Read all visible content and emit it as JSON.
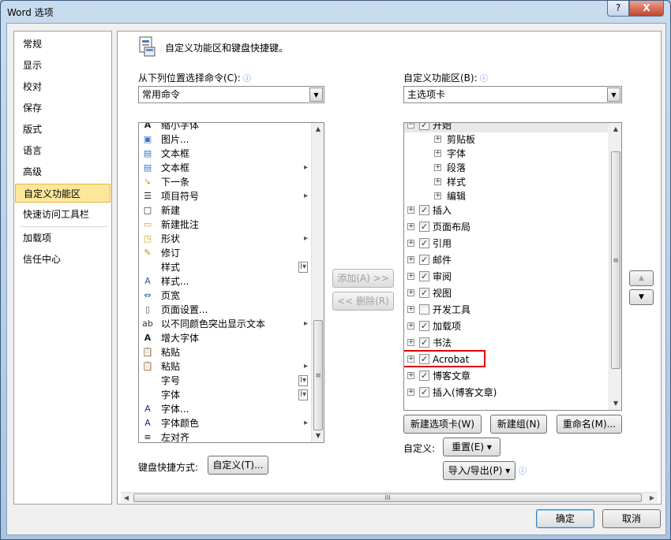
{
  "window": {
    "title": "Word 选项",
    "help": "?",
    "close": "X"
  },
  "nav": {
    "items": [
      "常规",
      "显示",
      "校对",
      "保存",
      "版式",
      "语言",
      "高级",
      "自定义功能区",
      "快速访问工具栏",
      "加载项",
      "信任中心"
    ],
    "selected": "自定义功能区"
  },
  "header": {
    "text": "自定义功能区和键盘快捷键。"
  },
  "left": {
    "label": "从下列位置选择命令(C):",
    "combo_value": "常用命令",
    "commands": [
      {
        "label": "缩小字体",
        "icon": "shrink-font-icon"
      },
      {
        "label": "图片...",
        "icon": "picture-icon"
      },
      {
        "label": "文本框",
        "icon": "textbox-icon"
      },
      {
        "label": "文本框",
        "icon": "textbox-icon",
        "sub": "▸"
      },
      {
        "label": "下一条",
        "icon": "next-icon"
      },
      {
        "label": "项目符号",
        "icon": "bullets-icon",
        "sub": "▸"
      },
      {
        "label": "新建",
        "icon": "new-icon"
      },
      {
        "label": "新建批注",
        "icon": "new-comment-icon"
      },
      {
        "label": "形状",
        "icon": "shapes-icon",
        "sub": "▸"
      },
      {
        "label": "修订",
        "icon": "track-changes-icon"
      },
      {
        "label": "样式",
        "icon": "",
        "sub": "I▾"
      },
      {
        "label": "样式...",
        "icon": "styles-icon"
      },
      {
        "label": "页宽",
        "icon": "page-width-icon"
      },
      {
        "label": "页面设置...",
        "icon": "page-setup-icon"
      },
      {
        "label": "以不同颜色突出显示文本",
        "icon": "highlight-icon",
        "sub": "▸"
      },
      {
        "label": "增大字体",
        "icon": "grow-font-icon"
      },
      {
        "label": "粘贴",
        "icon": "paste-icon"
      },
      {
        "label": "粘贴",
        "icon": "paste-icon",
        "sub": "▸"
      },
      {
        "label": "字号",
        "icon": "",
        "sub": "I▾"
      },
      {
        "label": "字体",
        "icon": "",
        "sub": "I▾"
      },
      {
        "label": "字体...",
        "icon": "font-dialog-icon"
      },
      {
        "label": "字体颜色",
        "icon": "font-color-icon",
        "sub": "▸"
      },
      {
        "label": "左对齐",
        "icon": "align-left-icon"
      }
    ]
  },
  "middle": {
    "add": "添加(A) >>",
    "remove": "<< 删除(R)"
  },
  "right": {
    "label": "自定义功能区(B):",
    "combo_value": "主选项卡",
    "tree": [
      {
        "label": "开始",
        "level": 0,
        "checked": true
      },
      {
        "label": "剪贴板",
        "level": 1
      },
      {
        "label": "字体",
        "level": 1
      },
      {
        "label": "段落",
        "level": 1
      },
      {
        "label": "样式",
        "level": 1
      },
      {
        "label": "编辑",
        "level": 1
      },
      {
        "label": "插入",
        "level": 0,
        "checked": true
      },
      {
        "label": "页面布局",
        "level": 0,
        "checked": true
      },
      {
        "label": "引用",
        "level": 0,
        "checked": true
      },
      {
        "label": "邮件",
        "level": 0,
        "checked": true
      },
      {
        "label": "审阅",
        "level": 0,
        "checked": true
      },
      {
        "label": "视图",
        "level": 0,
        "checked": true
      },
      {
        "label": "开发工具",
        "level": 0,
        "checked": false
      },
      {
        "label": "加载项",
        "level": 0,
        "checked": true
      },
      {
        "label": "书法",
        "level": 0,
        "checked": true
      },
      {
        "label": "Acrobat",
        "level": 0,
        "checked": true,
        "highlight": true
      },
      {
        "label": "博客文章",
        "level": 0,
        "checked": true
      },
      {
        "label": "插入(博客文章)",
        "level": 0,
        "checked": true
      }
    ],
    "highlight_color": "#e00000",
    "buttons": {
      "new_tab": "新建选项卡(W)",
      "new_group": "新建组(N)",
      "rename": "重命名(M)..."
    },
    "customize_label": "自定义:",
    "reset": "重置(E)",
    "import_export": "导入/导出(P)"
  },
  "keyboard": {
    "label": "键盘快捷方式:",
    "button": "自定义(T)..."
  },
  "footer": {
    "ok": "确定",
    "cancel": "取消"
  }
}
